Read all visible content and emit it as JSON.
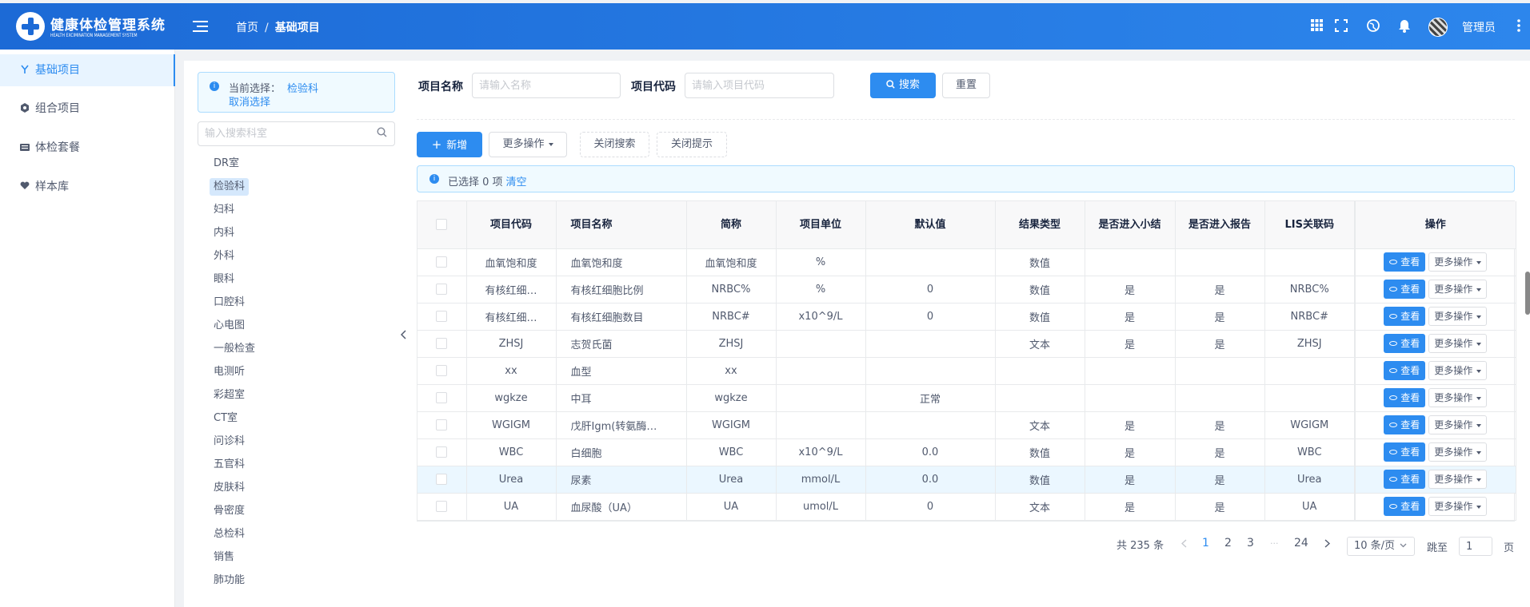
{
  "app": {
    "title": "健康体检管理系统",
    "subtitle": "HEALTH EXCIMINATION MANAGEMENT SYSTEM"
  },
  "breadcrumb": {
    "home": "首页",
    "sep": "/",
    "current": "基础项目"
  },
  "header": {
    "icons": [
      "grid-icon",
      "fullscreen-icon",
      "globe-icon",
      "bell-icon"
    ],
    "user": "管理员"
  },
  "sidebar": {
    "items": [
      {
        "label": "基础项目",
        "icon": "flask-icon",
        "active": true
      },
      {
        "label": "组合项目",
        "icon": "badge-icon",
        "active": false
      },
      {
        "label": "体检套餐",
        "icon": "keyboard-icon",
        "active": false
      },
      {
        "label": "样本库",
        "icon": "heart-icon",
        "active": false
      }
    ]
  },
  "dept_panel": {
    "current_label": "当前选择：",
    "current_value": "检验科",
    "cancel": "取消选择",
    "search_placeholder": "输入搜索科室",
    "depts": [
      "DR室",
      "检验科",
      "妇科",
      "内科",
      "外科",
      "眼科",
      "口腔科",
      "心电图",
      "一般检查",
      "电测听",
      "彩超室",
      "CT室",
      "问诊科",
      "五官科",
      "皮肤科",
      "骨密度",
      "总检科",
      "销售",
      "肺功能"
    ],
    "selected": "检验科"
  },
  "search": {
    "name_label": "项目名称",
    "name_placeholder": "请输入名称",
    "code_label": "项目代码",
    "code_placeholder": "请输入项目代码",
    "search_btn": "搜索",
    "reset_btn": "重置"
  },
  "toolbar": {
    "add": "新增",
    "more": "更多操作",
    "close_search": "关闭搜索",
    "close_tip": "关闭提示"
  },
  "selection": {
    "text": "已选择 0 项",
    "clear": "清空"
  },
  "table": {
    "columns": [
      "项目代码",
      "项目名称",
      "简称",
      "项目单位",
      "默认值",
      "结果类型",
      "是否进入小结",
      "是否进入报告",
      "LIS关联码",
      "操作"
    ],
    "rows": [
      [
        "血氧饱和度",
        "血氧饱和度",
        "血氧饱和度",
        "%",
        "",
        "数值",
        "",
        "",
        ""
      ],
      [
        "有核红细…",
        "有核红细胞比例",
        "NRBC%",
        "%",
        "0",
        "数值",
        "是",
        "是",
        "NRBC%"
      ],
      [
        "有核红细…",
        "有核红细胞数目",
        "NRBC#",
        "x10^9/L",
        "0",
        "数值",
        "是",
        "是",
        "NRBC#"
      ],
      [
        "ZHSJ",
        "志贺氏菌",
        "ZHSJ",
        "",
        "",
        "文本",
        "是",
        "是",
        "ZHSJ"
      ],
      [
        "xx",
        "血型",
        "xx",
        "",
        "",
        "",
        "",
        "",
        ""
      ],
      [
        "wgkze",
        "中耳",
        "wgkze",
        "",
        "正常",
        "",
        "",
        "",
        ""
      ],
      [
        "WGIGM",
        "戊肝Igm(转氨酶…",
        "WGIGM",
        "",
        "",
        "文本",
        "是",
        "是",
        "WGIGM"
      ],
      [
        "WBC",
        "白细胞",
        "WBC",
        "x10^9/L",
        "0.0",
        "数值",
        "是",
        "是",
        "WBC"
      ],
      [
        "Urea",
        "尿素",
        "Urea",
        "mmol/L",
        "0.0",
        "数值",
        "是",
        "是",
        "Urea"
      ],
      [
        "UA",
        "血尿酸（UA）",
        "UA",
        "umol/L",
        "0",
        "文本",
        "是",
        "是",
        "UA"
      ]
    ],
    "highlighted_row": 8,
    "view_btn": "查看",
    "more_btn": "更多操作"
  },
  "pagination": {
    "total": "共 235 条",
    "pages": [
      "1",
      "2",
      "3",
      "···",
      "24"
    ],
    "current": "1",
    "page_size": "10 条/页",
    "jump_label": "跳至",
    "jump_value": "1",
    "page_suffix": "页"
  },
  "colors": {
    "primary": "#2d8cf0",
    "header_start": "#1c6ad6",
    "header_end": "#2d86ec"
  }
}
